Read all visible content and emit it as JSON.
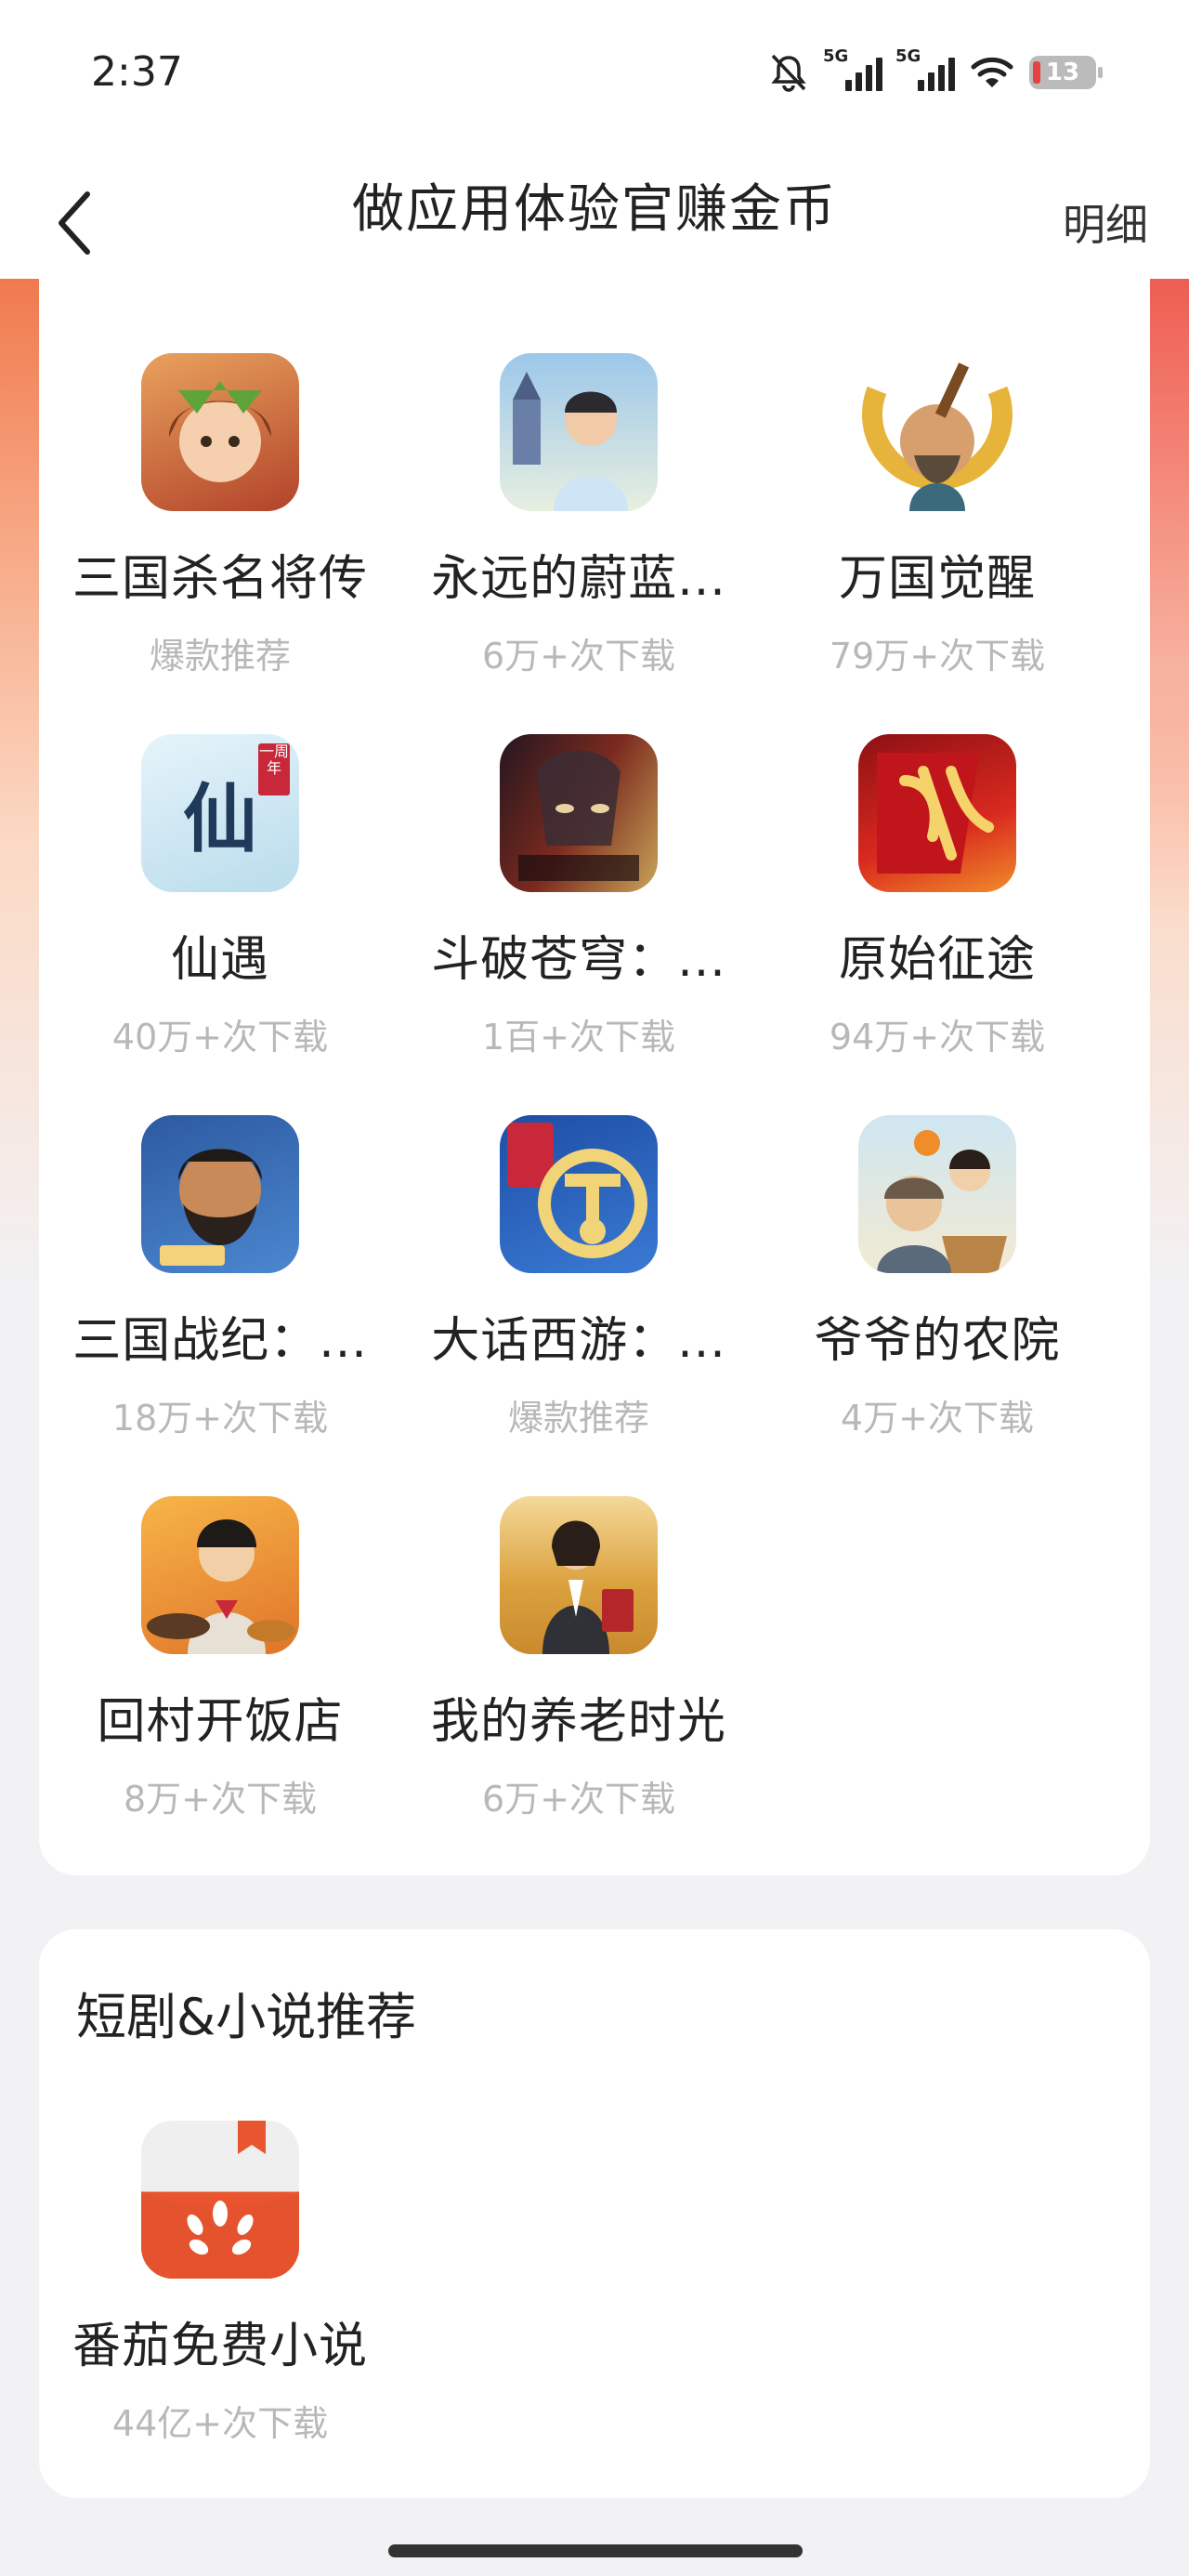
{
  "status": {
    "time": "2:37",
    "signal1_label": "5G",
    "signal2_label": "5G",
    "battery": "13"
  },
  "nav": {
    "title": "做应用体验官赚金币",
    "detail": "明细"
  },
  "games": [
    {
      "name": "三国杀名将传",
      "sub": "爆款推荐",
      "icon": "hero-girl-icon",
      "color": "#c8633a"
    },
    {
      "name": "永远的蔚蓝...",
      "sub": "6万+次下载",
      "icon": "castle-man-icon",
      "color": "#8fb7da"
    },
    {
      "name": "万国觉醒",
      "sub": "79万+次下载",
      "icon": "sage-warrior-icon",
      "color": "#d9a22c"
    },
    {
      "name": "仙遇",
      "sub": "40万+次下载",
      "icon": "xianyu-calligraphy-icon",
      "color": "#cfe8f2"
    },
    {
      "name": "斗破苍穹：...",
      "sub": "1百+次下载",
      "icon": "dark-warrior-icon",
      "color": "#4b2f3a"
    },
    {
      "name": "原始征途",
      "sub": "94万+次下载",
      "icon": "red-banner-icon",
      "color": "#b3161a"
    },
    {
      "name": "三国战纪：...",
      "sub": "18万+次下载",
      "icon": "bearded-general-icon",
      "color": "#3c6db3"
    },
    {
      "name": "大话西游：...",
      "sub": "爆款推荐",
      "icon": "yuanqi-emblem-icon",
      "color": "#2b5fb3"
    },
    {
      "name": "爷爷的农院",
      "sub": "4万+次下载",
      "icon": "grandpa-farm-icon",
      "color": "#a8c77a"
    },
    {
      "name": "回村开饭店",
      "sub": "8万+次下载",
      "icon": "village-cook-icon",
      "color": "#e99a3a"
    },
    {
      "name": "我的养老时光",
      "sub": "6万+次下载",
      "icon": "businesswoman-field-icon",
      "color": "#e5a44a"
    }
  ],
  "novel_section": {
    "title": "短剧&小说推荐",
    "apps": [
      {
        "name": "番茄免费小说",
        "sub": "44亿+次下载",
        "icon": "tomato-book-icon",
        "color": "#e8552f"
      }
    ]
  }
}
